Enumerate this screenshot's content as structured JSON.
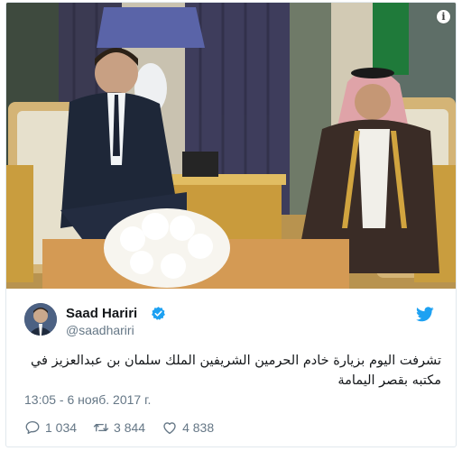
{
  "photo": {
    "description_icon": "info-icon",
    "info_glyph": "i"
  },
  "tweet": {
    "author": {
      "display_name": "Saad Hariri",
      "handle": "@saadhariri",
      "verified_icon": "verified-badge-icon",
      "avatar_icon": "avatar"
    },
    "platform_icon": "twitter-bird-icon",
    "text": "تشرفت اليوم بزيارة خادم الحرمين الشريفين الملك سلمان بن عبدالعزيز في مكتبه بقصر اليمامة",
    "timestamp": "13:05 - 6 нояб. 2017 г.",
    "actions": {
      "reply": {
        "icon": "reply-icon",
        "count": "1 034"
      },
      "retweet": {
        "icon": "retweet-icon",
        "count": "3 844"
      },
      "like": {
        "icon": "heart-icon",
        "count": "4 838"
      }
    }
  },
  "colors": {
    "text_primary": "#14171a",
    "text_secondary": "#657786",
    "twitter_blue": "#1da1f2",
    "border": "#e1e8ed"
  }
}
